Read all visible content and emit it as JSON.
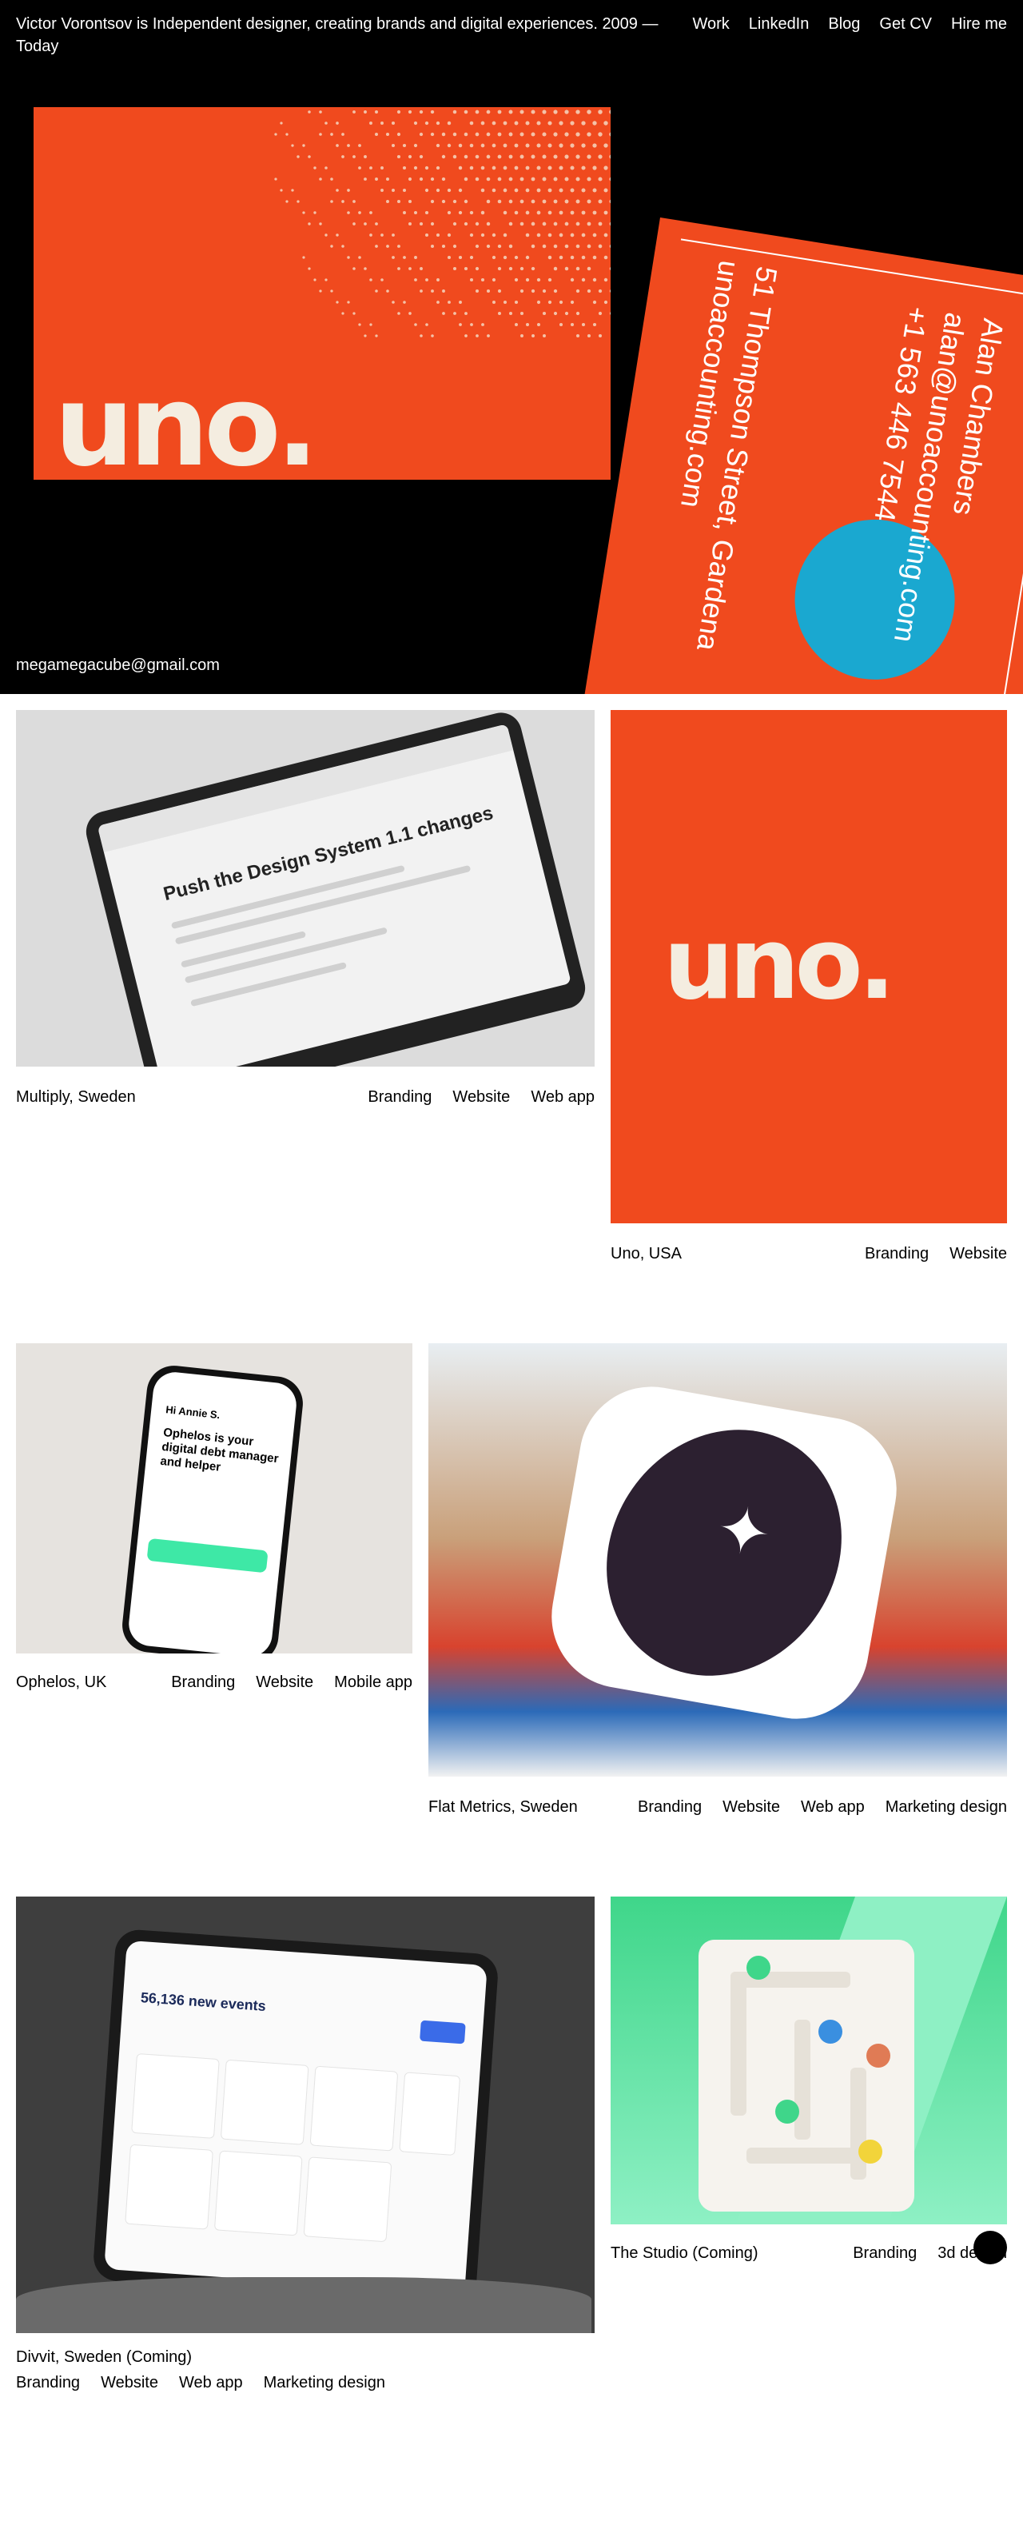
{
  "header": {
    "intro": "Victor Vorontsov is Independent designer, creating brands and digital experiences. 2009 — Today",
    "nav": [
      "Work",
      "LinkedIn",
      "Blog",
      "Get CV",
      "Hire me"
    ],
    "email": "megamegacube@gmail.com"
  },
  "hero": {
    "logo_text": "uno.",
    "card_back": {
      "name": "Alan Chambers",
      "email": "alan@unoaccounting.com",
      "phone": "+1 563 446 7544",
      "street": "51 Thompson Street, Gardena",
      "site": "unoaccounting.com"
    }
  },
  "projects": [
    {
      "title": "Multiply, Sweden",
      "tags": [
        "Branding",
        "Website",
        "Web app"
      ],
      "screen_heading": "Push the Design System 1.1 changes"
    },
    {
      "title": "Uno, USA",
      "tags": [
        "Branding",
        "Website"
      ],
      "logo_text": "uno."
    },
    {
      "title": "Ophelos, UK",
      "tags": [
        "Branding",
        "Website",
        "Mobile app"
      ],
      "greeting": "Hi Annie S.",
      "headline": "Ophelos is your digital debt manager and helper"
    },
    {
      "title": "Flat Metrics, Sweden",
      "tags": [
        "Branding",
        "Website",
        "Web app",
        "Marketing design"
      ]
    },
    {
      "title": "Divvit, Sweden (Coming)",
      "tags": [
        "Branding",
        "Website",
        "Web app",
        "Marketing design"
      ],
      "screen_heading": "56,136 new events"
    },
    {
      "title": "The Studio (Coming)",
      "tags": [
        "Branding",
        "3d design"
      ]
    }
  ],
  "colors": {
    "brand_orange": "#f04a1e",
    "cream": "#f4ede0",
    "accent_blue": "#1aa8d0",
    "accent_green": "#3ee8a6"
  }
}
